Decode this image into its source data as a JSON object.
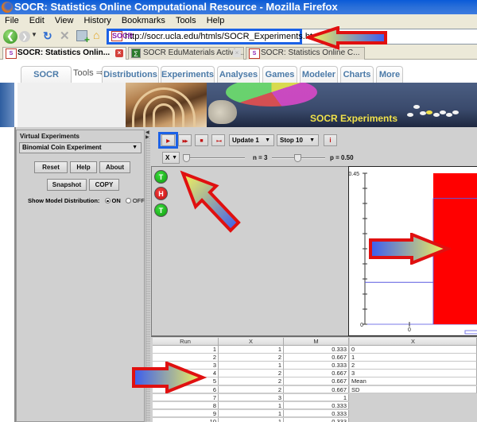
{
  "window": {
    "title": "SOCR: Statistics Online Computational Resource - Mozilla Firefox"
  },
  "menubar": [
    "File",
    "Edit",
    "View",
    "History",
    "Bookmarks",
    "Tools",
    "Help"
  ],
  "navbar": {
    "url": "http://socr.ucla.edu/htmls/SOCR_Experiments.html",
    "favicon": "SOCR"
  },
  "browser_tabs": [
    {
      "label": "SOCR: Statistics Onlin...",
      "active": true
    },
    {
      "label": "SOCR EduMaterials Activit...",
      "active": false
    },
    {
      "label": "SOCR: Statistics Online C...",
      "active": false
    }
  ],
  "site": {
    "home_tab": "SOCR Home",
    "tools_label": "Tools ⇒",
    "tabs": [
      "Distributions",
      "Experiments",
      "Analyses",
      "Games",
      "Modeler",
      "Charts",
      "More"
    ],
    "banner_title": "SOCR Experiments"
  },
  "left_panel": {
    "title": "Virtual Experiments",
    "experiment_selected": "Binomial Coin Experiment",
    "buttons": {
      "reset": "Reset",
      "help": "Help",
      "about": "About",
      "snapshot": "Snapshot",
      "copy": "COPY"
    },
    "model_dist_label": "Show Model Distribution:",
    "on_label": "ON",
    "off_label": "OFF",
    "model_dist_value": "ON"
  },
  "toolbar": {
    "play_icon": "▶",
    "fastforward_icon": "▶▶",
    "stop_icon": "■",
    "reset_icon": "⇤⇥",
    "update_combo": "Update 1",
    "stop_combo": "Stop 10",
    "info_icon": "i",
    "variable_combo": "X",
    "n_label": "n = 3",
    "n_value": 3,
    "n_range": [
      1,
      100
    ],
    "p_label": "p = 0.50",
    "p_value": 0.5
  },
  "balls": [
    "T",
    "H",
    "T"
  ],
  "graph": {
    "y_max_label": "0.45",
    "y_min_label": "0",
    "x_label": "0",
    "y_max": 0.45,
    "model_values": {
      "0": 0.125,
      "1": 0.375
    },
    "empirical_values": {
      "1": 0.45
    }
  },
  "table": {
    "headers": [
      "Run",
      "X",
      "M"
    ],
    "rows": [
      [
        "1",
        "1",
        "0.333"
      ],
      [
        "2",
        "2",
        "0.667"
      ],
      [
        "3",
        "1",
        "0.333"
      ],
      [
        "4",
        "2",
        "0.667"
      ],
      [
        "5",
        "2",
        "0.667"
      ],
      [
        "6",
        "2",
        "0.667"
      ],
      [
        "7",
        "3",
        "1"
      ],
      [
        "8",
        "1",
        "0.333"
      ],
      [
        "9",
        "1",
        "0.333"
      ],
      [
        "10",
        "1",
        "0.333"
      ]
    ],
    "dist_header": "X",
    "dist_rows": [
      "0",
      "1",
      "2",
      "3",
      "Mean",
      "SD"
    ]
  }
}
